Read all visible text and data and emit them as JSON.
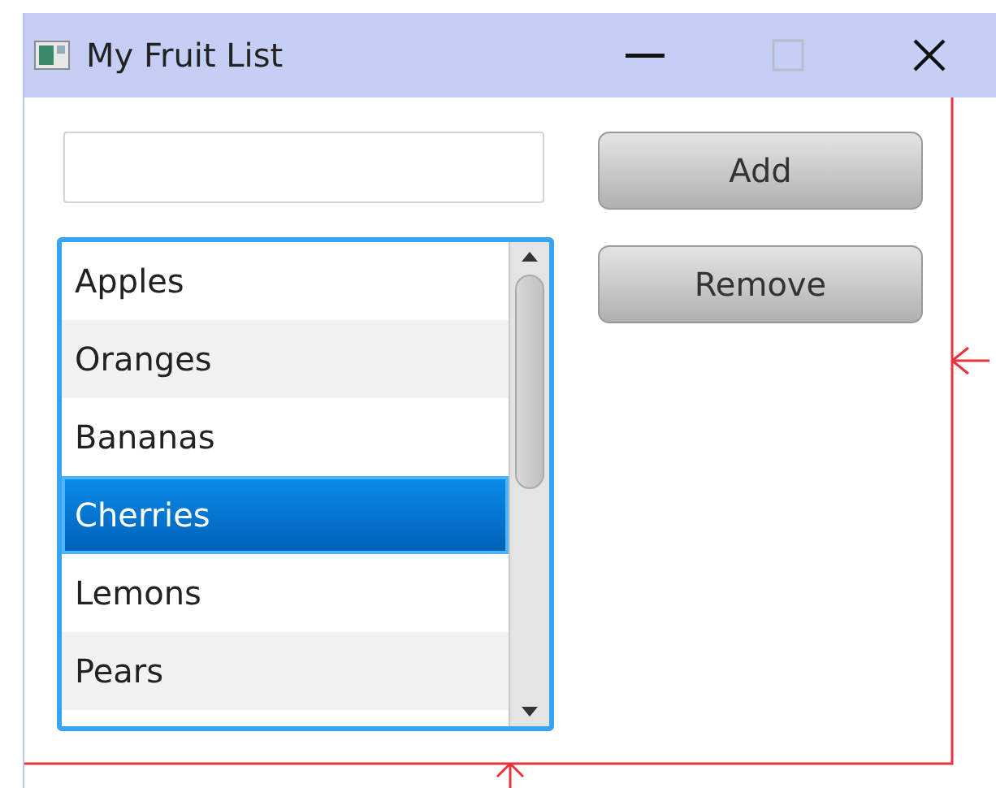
{
  "window": {
    "title": "My Fruit List"
  },
  "buttons": [
    {
      "label": "Add"
    },
    {
      "label": "Remove"
    }
  ],
  "list": {
    "items": [
      {
        "label": "Apples",
        "selected": false
      },
      {
        "label": "Oranges",
        "selected": false
      },
      {
        "label": "Bananas",
        "selected": false
      },
      {
        "label": "Cherries",
        "selected": true
      },
      {
        "label": "Lemons",
        "selected": false
      },
      {
        "label": "Pears",
        "selected": false
      }
    ]
  }
}
